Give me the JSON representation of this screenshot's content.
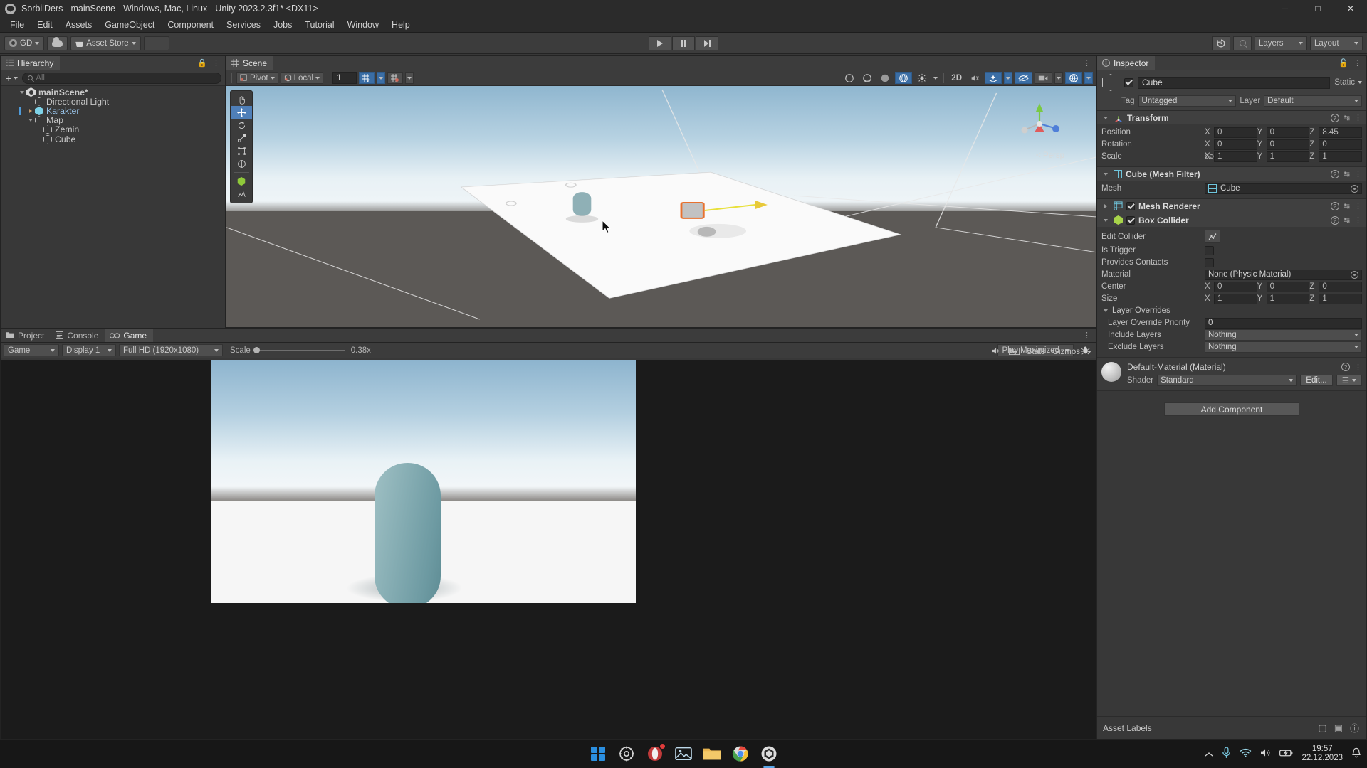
{
  "window": {
    "title": "SorbilDers - mainScene - Windows, Mac, Linux - Unity 2023.2.3f1* <DX11>",
    "minimize": "─",
    "maximize": "□",
    "close": "✕"
  },
  "menubar": {
    "items": [
      "File",
      "Edit",
      "Assets",
      "GameObject",
      "Component",
      "Services",
      "Jobs",
      "Tutorial",
      "Window",
      "Help"
    ]
  },
  "toolbar": {
    "account_label": "GD",
    "asset_store_label": "Asset Store",
    "play_label": "play-button",
    "pause_label": "pause-button",
    "step_label": "step-button",
    "layers_label": "Layers",
    "layout_label": "Layout",
    "history_icon": "history-icon",
    "search_icon": "search-icon"
  },
  "hierarchy": {
    "tab": "Hierarchy",
    "add_label": "+",
    "search_placeholder": "All",
    "items": [
      {
        "label": "mainScene*",
        "depth": 0,
        "icon": "scene-icon",
        "arrow": "open",
        "selected": false,
        "highlight": false
      },
      {
        "label": "Directional Light",
        "depth": 1,
        "icon": "gameobject-icon",
        "arrow": "none",
        "selected": false,
        "highlight": false
      },
      {
        "label": "Karakter",
        "depth": 1,
        "icon": "prefab-icon",
        "arrow": "closed",
        "selected": false,
        "highlight": true
      },
      {
        "label": "Map",
        "depth": 1,
        "icon": "gameobject-icon",
        "arrow": "open",
        "selected": false,
        "highlight": false
      },
      {
        "label": "Zemin",
        "depth": 2,
        "icon": "gameobject-icon",
        "arrow": "none",
        "selected": false,
        "highlight": false
      },
      {
        "label": "Cube",
        "depth": 2,
        "icon": "gameobject-icon",
        "arrow": "none",
        "selected": true,
        "highlight": false
      }
    ]
  },
  "scene": {
    "tab": "Scene",
    "pivot_label": "Pivot",
    "local_label": "Local",
    "grid_value": "1",
    "twod_label": "2D",
    "persp_label": "< Persp",
    "tools": [
      "hand-tool",
      "move-tool",
      "rotate-tool",
      "scale-tool",
      "rect-tool",
      "transform-tool",
      "custom-tool",
      "collider-tool"
    ]
  },
  "bottom_panel": {
    "tabs": [
      {
        "label": "Project",
        "icon": "folder-icon",
        "active": false
      },
      {
        "label": "Console",
        "icon": "console-icon",
        "active": false
      },
      {
        "label": "Game",
        "icon": "game-icon",
        "active": true
      }
    ],
    "view_dropdown": "Game",
    "display_dropdown": "Display 1",
    "resolution_dropdown": "Full HD (1920x1080)",
    "scale_label": "Scale",
    "scale_value": "0.38x",
    "play_maximized": "Play Maximized",
    "mute_icon": "mute-audio-icon",
    "stats_label": "Stats",
    "gizmos_label": "Gizmos",
    "debug_icon": "debug-icon"
  },
  "inspector": {
    "tab": "Inspector",
    "object_name": "Cube",
    "static_label": "Static",
    "tag_label": "Tag",
    "tag_value": "Untagged",
    "layer_label": "Layer",
    "layer_value": "Default",
    "components": [
      {
        "title": "Transform",
        "icon": "transform-icon",
        "rows": [
          {
            "label": "Position",
            "type": "vec3",
            "x": "0",
            "y": "0",
            "z": "8.45"
          },
          {
            "label": "Rotation",
            "type": "vec3",
            "x": "0",
            "y": "0",
            "z": "0"
          },
          {
            "label": "Scale",
            "type": "vec3",
            "x": "1",
            "y": "1",
            "z": "1",
            "link": true
          }
        ]
      },
      {
        "title": "Cube (Mesh Filter)",
        "icon": "mesh-filter-icon",
        "rows": [
          {
            "label": "Mesh",
            "type": "object",
            "value": "Cube"
          }
        ]
      },
      {
        "title": "Mesh Renderer",
        "icon": "mesh-renderer-icon",
        "collapsed": true,
        "checked": true,
        "rows": []
      },
      {
        "title": "Box Collider",
        "icon": "box-collider-icon",
        "checked": true,
        "rows": [
          {
            "label": "Edit Collider",
            "type": "button"
          },
          {
            "label": "Is Trigger",
            "type": "checkbox",
            "value": false
          },
          {
            "label": "Provides Contacts",
            "type": "checkbox",
            "value": false
          },
          {
            "label": "Material",
            "type": "object",
            "value": "None (Physic Material)"
          },
          {
            "label": "Center",
            "type": "vec3",
            "x": "0",
            "y": "0",
            "z": "0"
          },
          {
            "label": "Size",
            "type": "vec3",
            "x": "1",
            "y": "1",
            "z": "1"
          },
          {
            "label": "Layer Overrides",
            "type": "foldout"
          },
          {
            "label": "Layer Override Priority",
            "type": "text",
            "value": "0",
            "indent": true
          },
          {
            "label": "Include Layers",
            "type": "dropdown",
            "value": "Nothing",
            "indent": true
          },
          {
            "label": "Exclude Layers",
            "type": "dropdown",
            "value": "Nothing",
            "indent": true
          }
        ]
      }
    ],
    "material": {
      "title": "Default-Material (Material)",
      "shader_label": "Shader",
      "shader_value": "Standard",
      "edit_label": "Edit..."
    },
    "add_component_label": "Add Component",
    "asset_labels_title": "Asset Labels"
  },
  "taskbar": {
    "items": [
      {
        "name": "start-button",
        "icon": "windows-logo"
      },
      {
        "name": "settings-app",
        "icon": "gear-icon"
      },
      {
        "name": "browser-app",
        "icon": "opera-icon",
        "badge": true
      },
      {
        "name": "photos-app",
        "icon": "photos-icon"
      },
      {
        "name": "file-explorer",
        "icon": "folder-icon"
      },
      {
        "name": "chrome-app",
        "icon": "chrome-icon"
      },
      {
        "name": "unity-app",
        "icon": "unity-icon",
        "active": true
      }
    ],
    "tray": {
      "chevron": "show-hidden-icons",
      "mic": "microphone-icon",
      "wifi": "wifi-icon",
      "volume": "volume-icon",
      "battery": "battery-icon",
      "time": "19:57",
      "date": "22.12.2023",
      "notifications": "notification-bell-icon"
    }
  },
  "colors": {
    "accent": "#4f9ad8",
    "panel_bg": "#383838",
    "toolbar_bg": "#3c3c3c",
    "selected_row": "#4a4a4a",
    "gizmo_x": "#e05b5b",
    "gizmo_y": "#7ac943",
    "gizmo_z": "#4f7fd8"
  }
}
